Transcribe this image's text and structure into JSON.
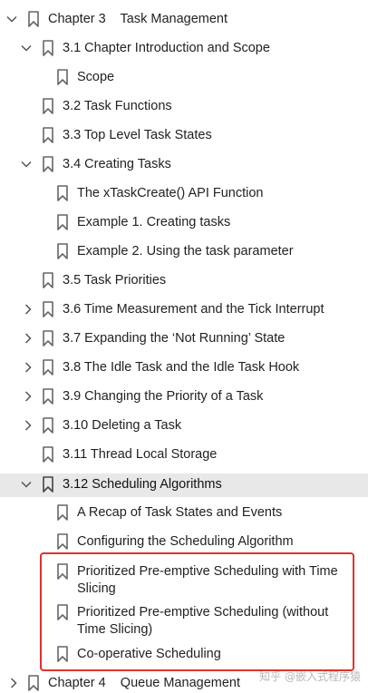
{
  "bookmarks": {
    "chapter3": {
      "label": "Chapter 3    Task Management",
      "expanded": true
    },
    "s3_1": {
      "label": "3.1 Chapter Introduction and Scope",
      "expanded": true
    },
    "s3_1_scope": {
      "label": "Scope"
    },
    "s3_2": {
      "label": "3.2 Task Functions"
    },
    "s3_3": {
      "label": "3.3 Top Level Task States"
    },
    "s3_4": {
      "label": "3.4 Creating Tasks",
      "expanded": true
    },
    "s3_4_a": {
      "label": "The xTaskCreate() API Function"
    },
    "s3_4_b": {
      "label": "Example 1. Creating tasks"
    },
    "s3_4_c": {
      "label": "Example 2. Using the task parameter"
    },
    "s3_5": {
      "label": "3.5 Task Priorities"
    },
    "s3_6": {
      "label": "3.6 Time Measurement and the Tick Interrupt",
      "expanded": false
    },
    "s3_7": {
      "label": "3.7 Expanding the ‘Not Running’ State",
      "expanded": false
    },
    "s3_8": {
      "label": "3.8 The Idle Task and the Idle Task Hook",
      "expanded": false
    },
    "s3_9": {
      "label": "3.9 Changing the Priority of a Task",
      "expanded": false
    },
    "s3_10": {
      "label": "3.10 Deleting a Task",
      "expanded": false
    },
    "s3_11": {
      "label": "3.11 Thread Local Storage"
    },
    "s3_12": {
      "label": "3.12 Scheduling Algorithms",
      "expanded": true,
      "selected": true
    },
    "s3_12_a": {
      "label": "A Recap of Task States and Events"
    },
    "s3_12_b": {
      "label": "Configuring the Scheduling Algorithm"
    },
    "s3_12_c": {
      "label": "Prioritized Pre-emptive Scheduling with Time Slicing"
    },
    "s3_12_d": {
      "label": "Prioritized Pre-emptive Scheduling (without Time Slicing)"
    },
    "s3_12_e": {
      "label": "Co-operative Scheduling"
    },
    "chapter4": {
      "label": "Chapter 4    Queue Management",
      "expanded": false
    }
  },
  "watermark": "知乎 @嵌入式程序猿",
  "colors": {
    "highlight_box": "#e0322d",
    "selected_row": "#e8e8e8",
    "icon": "#666666"
  },
  "icons": {
    "bookmark": "bookmark-icon",
    "expanded": "chevron-down-icon",
    "collapsed": "chevron-right-icon"
  }
}
